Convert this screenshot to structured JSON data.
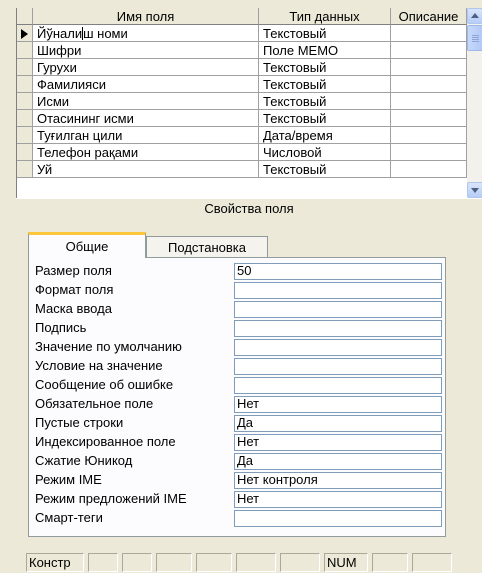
{
  "grid": {
    "headers": [
      "Имя поля",
      "Тип данных",
      "Описание"
    ],
    "rows": [
      {
        "name": "Йўнали|ш номи",
        "type": "Текстовый",
        "desc": ""
      },
      {
        "name": "Шифри",
        "type": "Поле MEMO",
        "desc": ""
      },
      {
        "name": "Гурухи",
        "type": "Текстовый",
        "desc": ""
      },
      {
        "name": "Фамилияси",
        "type": "Текстовый",
        "desc": ""
      },
      {
        "name": "Исми",
        "type": "Текстовый",
        "desc": ""
      },
      {
        "name": "Отасининг исми",
        "type": "Текстовый",
        "desc": ""
      },
      {
        "name": "Туғилган цили",
        "type": "Дата/время",
        "desc": ""
      },
      {
        "name": "Телефон рақами",
        "type": "Числовой",
        "desc": ""
      },
      {
        "name": "Уй",
        "type": "Текстовый",
        "desc": ""
      }
    ]
  },
  "properties": {
    "title": "Свойства поля",
    "tabs": [
      "Общие",
      "Подстановка"
    ],
    "rows": [
      {
        "label": "Размер поля",
        "value": "50"
      },
      {
        "label": "Формат поля",
        "value": ""
      },
      {
        "label": "Маска ввода",
        "value": ""
      },
      {
        "label": "Подпись",
        "value": ""
      },
      {
        "label": "Значение по умолчанию",
        "value": ""
      },
      {
        "label": "Условие на значение",
        "value": ""
      },
      {
        "label": "Сообщение об ошибке",
        "value": ""
      },
      {
        "label": "Обязательное поле",
        "value": "Нет"
      },
      {
        "label": "Пустые строки",
        "value": "Да"
      },
      {
        "label": "Индексированное поле",
        "value": "Нет"
      },
      {
        "label": "Сжатие Юникод",
        "value": "Да"
      },
      {
        "label": "Режим IME",
        "value": "Нет контроля"
      },
      {
        "label": "Режим предложений IME",
        "value": "Нет"
      },
      {
        "label": "Смарт-теги",
        "value": ""
      }
    ]
  },
  "statusbar": {
    "mode": "Констр",
    "num": "NUM"
  },
  "colors": {
    "window_bg": "#ece9d8",
    "active_tab_accent": "#ffc83c",
    "field_border": "#7f9db9"
  },
  "icons": {
    "row_selector": "current-row-arrow-icon",
    "scroll_up": "chevron-up-icon",
    "scroll_down": "chevron-down-icon"
  }
}
